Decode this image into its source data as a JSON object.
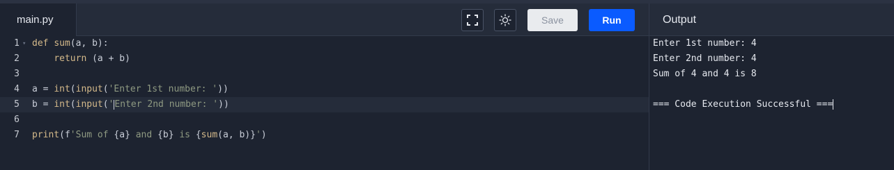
{
  "editor": {
    "file_name": "main.py",
    "save_label": "Save",
    "run_label": "Run",
    "lines": [
      {
        "num": "1",
        "text": "def sum(a, b):"
      },
      {
        "num": "2",
        "text": "    return (a + b)"
      },
      {
        "num": "3",
        "text": ""
      },
      {
        "num": "4",
        "text": "a = int(input('Enter 1st number: '))"
      },
      {
        "num": "5",
        "text": "b = int(input('Enter 2nd number: '))"
      },
      {
        "num": "6",
        "text": ""
      },
      {
        "num": "7",
        "text": "print(f'Sum of {a} and {b} is {sum(a, b)}')"
      }
    ]
  },
  "output": {
    "title": "Output",
    "lines": [
      "Enter 1st number: 4",
      "Enter 2nd number: 4",
      "Sum of 4 and 4 is 8",
      "",
      "=== Code Execution Successful ==="
    ]
  },
  "icons": {
    "fullscreen": "fullscreen-icon",
    "theme": "sun-icon",
    "fold": "fold-arrow-icon"
  },
  "colors": {
    "background": "#1d2330",
    "header": "#252c3a",
    "run_button": "#0a5bff",
    "save_button": "#e9ebee",
    "keyword": "#d4b98a",
    "string": "#8f9a82"
  }
}
